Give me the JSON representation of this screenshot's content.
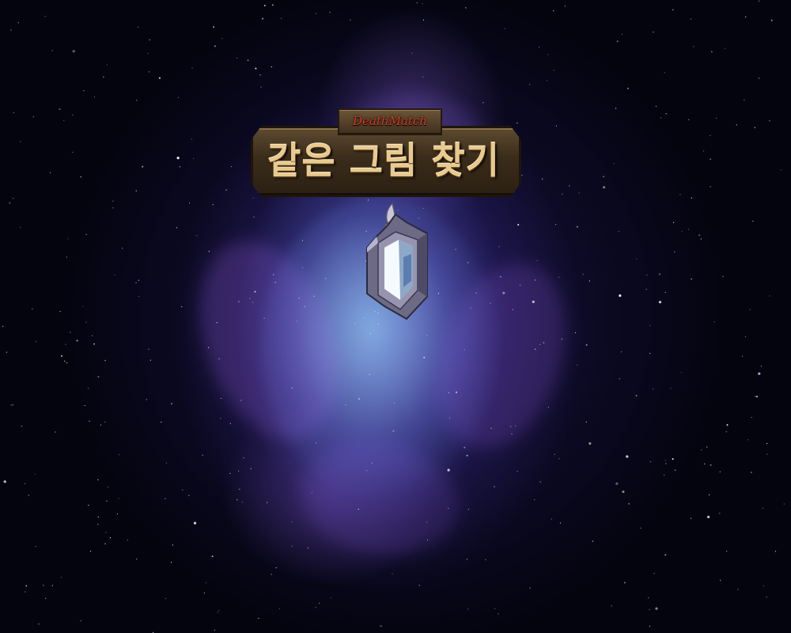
{
  "game": {
    "subtitle": "DeathMatch",
    "title": "같은 그림 찾기"
  },
  "emblem": {
    "icon": "crystal-shield-emblem-icon"
  },
  "colors": {
    "background": "#04040f",
    "nebula_blue": "#78c8ff",
    "nebula_purple": "#825adc",
    "title_gold": "#e9c98d",
    "subtitle_red": "#d23a22"
  }
}
